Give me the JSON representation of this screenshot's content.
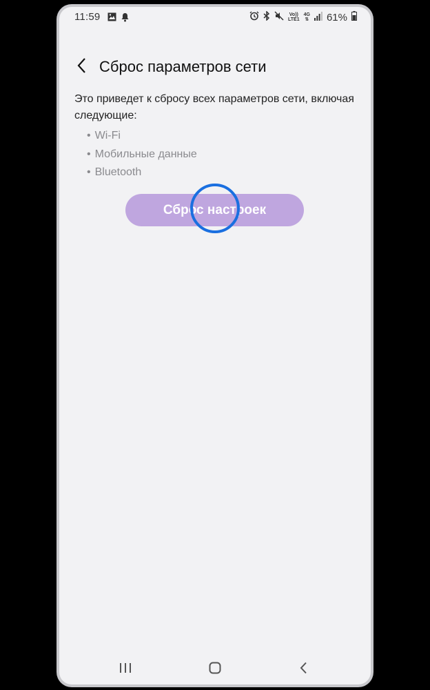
{
  "status_bar": {
    "time": "11:59",
    "network_top": "Vo))",
    "network_bottom": "LTE1",
    "network_type": "4G",
    "battery_percent": "61%",
    "icons": [
      "gallery-icon",
      "notification-icon",
      "alarm-icon",
      "bluetooth-icon",
      "mute-icon",
      "volte-icon",
      "signal-icon",
      "battery-icon"
    ]
  },
  "header": {
    "title": "Сброс параметров сети",
    "back_icon": "chevron-left-icon"
  },
  "content": {
    "description": "Это приведет к сбросу всех параметров сети, включая следующие:",
    "items": [
      {
        "bullet": "•",
        "label": "Wi-Fi"
      },
      {
        "bullet": "•",
        "label": "Мобильные данные"
      },
      {
        "bullet": "•",
        "label": "Bluetooth"
      }
    ],
    "reset_button_label": "Сброс настроек"
  },
  "nav_bar": {
    "buttons": [
      "recent-apps-icon",
      "home-icon",
      "back-icon"
    ]
  },
  "colors": {
    "screen_background": "#f2f2f4",
    "button_background": "#bfa6df",
    "tap_indicator": "#1a6fe0"
  }
}
